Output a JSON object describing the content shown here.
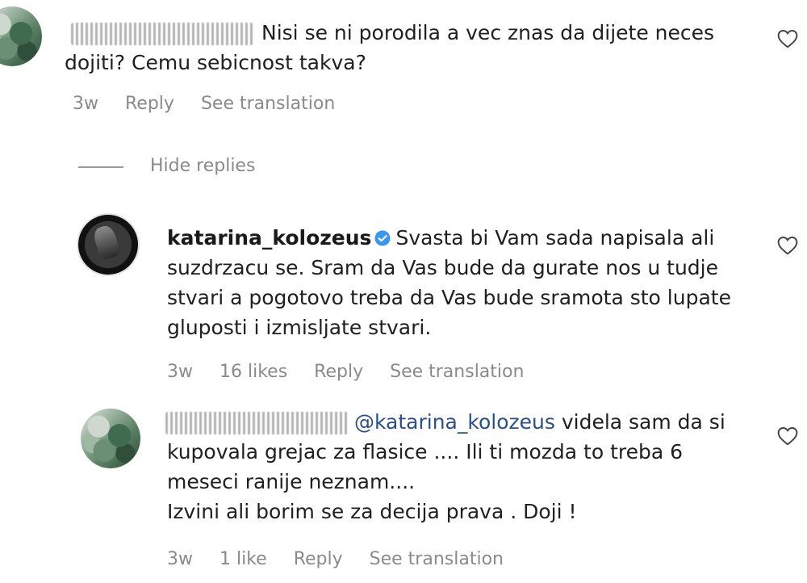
{
  "comments": [
    {
      "text": "Nisi se ni porodila a vec znas da dijete neces dojiti? Cemu sebicnost takva?",
      "time": "3w",
      "reply_label": "Reply",
      "translation_label": "See translation"
    }
  ],
  "replies_toggle": {
    "label": "Hide replies"
  },
  "replies": [
    {
      "username": "katarina_kolozeus",
      "verified": true,
      "text": "Svasta bi Vam sada napisala ali suzdrzacu se. Sram da Vas bude da gurate nos u tudje stvari a pogotovo treba da Vas bude sramota sto lupate gluposti i izmisljate stvari.",
      "time": "3w",
      "likes": "16 likes",
      "reply_label": "Reply",
      "translation_label": "See translation"
    },
    {
      "mention": "@katarina_kolozeus",
      "text": "videla sam da si kupovala grejac za flasice .... Ili ti mozda to treba 6 meseci ranije neznam....",
      "text2": "Izvini ali borim se za decija prava . Doji !",
      "time": "3w",
      "likes": "1 like",
      "reply_label": "Reply",
      "translation_label": "See translation"
    }
  ],
  "icons": {
    "like": "heart-outline-icon",
    "verified": "verified-badge-icon"
  },
  "colors": {
    "meta": "#8a8a8a",
    "mention": "#2a4f8a",
    "verified": "#3897f0"
  }
}
